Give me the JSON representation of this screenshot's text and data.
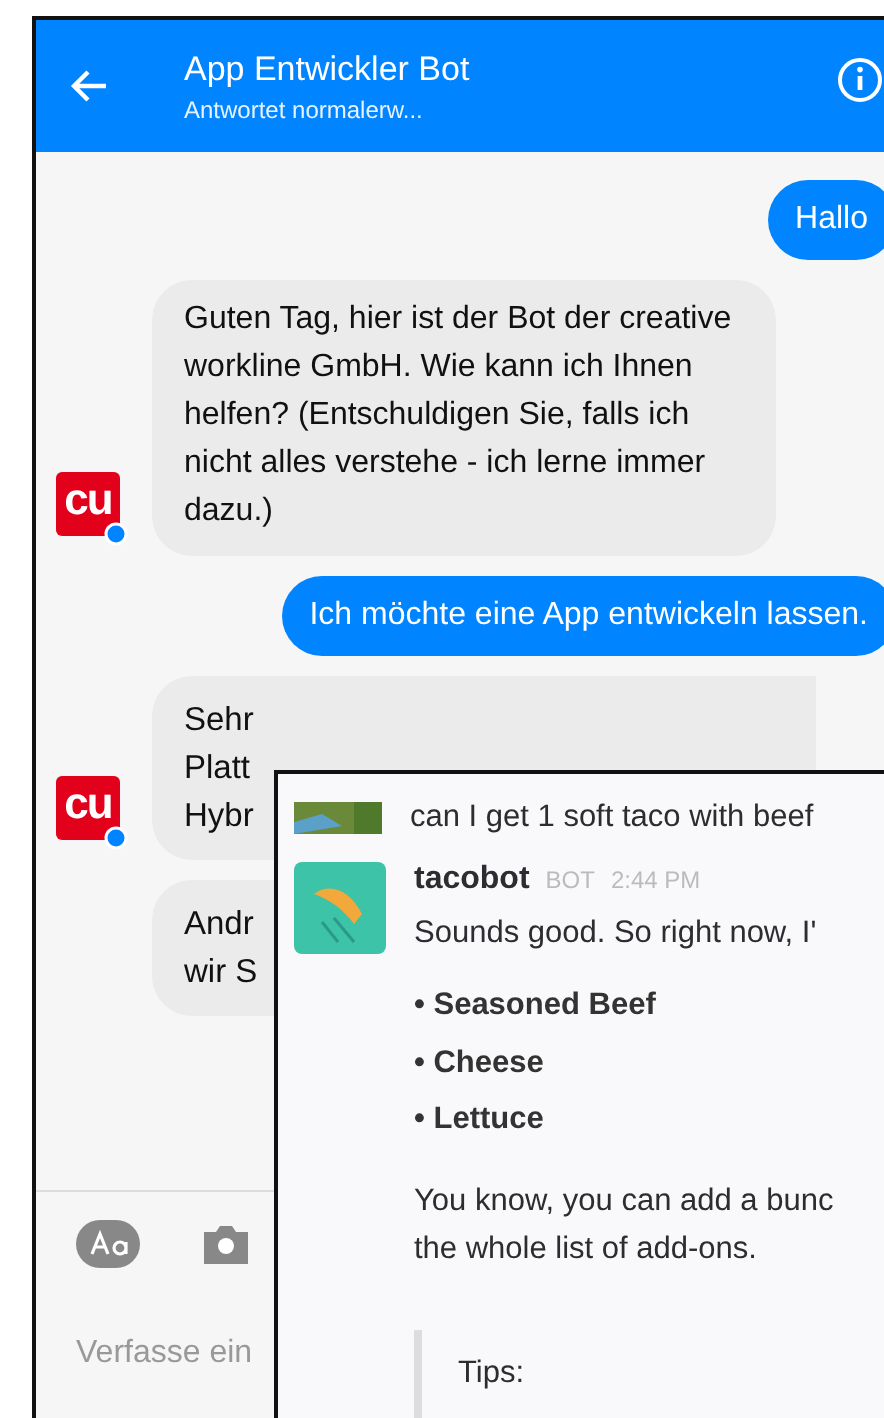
{
  "header": {
    "title": "App Entwickler Bot",
    "subtitle": "Antwortet normalerw..."
  },
  "messages": [
    {
      "kind": "outgoing",
      "text": "Hallo"
    },
    {
      "kind": "incoming",
      "text": "Guten Tag, hier ist der Bot der creative workline GmbH. Wie kann ich Ihnen helfen? (Entschuldigen Sie, falls ich nicht alles verstehe - ich lerne immer dazu.)",
      "avatar": "cu"
    },
    {
      "kind": "outgoing",
      "text": "Ich möchte eine App entwickeln lassen."
    },
    {
      "kind": "incoming-cut",
      "lines": [
        "Sehr",
        "Platt",
        "Hybr"
      ],
      "avatar": "cu"
    },
    {
      "kind": "incoming-cut",
      "lines": [
        "Andr",
        "wir S"
      ]
    }
  ],
  "composer": {
    "placeholder": "Verfasse ein"
  },
  "overlay": {
    "user_message": "can I get 1 soft taco with beef",
    "bot": {
      "name": "tacobot",
      "badge": "BOT",
      "time": "2:44 PM",
      "text": "Sounds good. So right now, I'",
      "bullet": "•",
      "items": [
        "Seasoned Beef",
        "Cheese",
        "Lettuce"
      ],
      "followup": [
        "You know, you can add a bunc",
        "the whole list of add-ons."
      ],
      "quote": "Tips:"
    }
  }
}
